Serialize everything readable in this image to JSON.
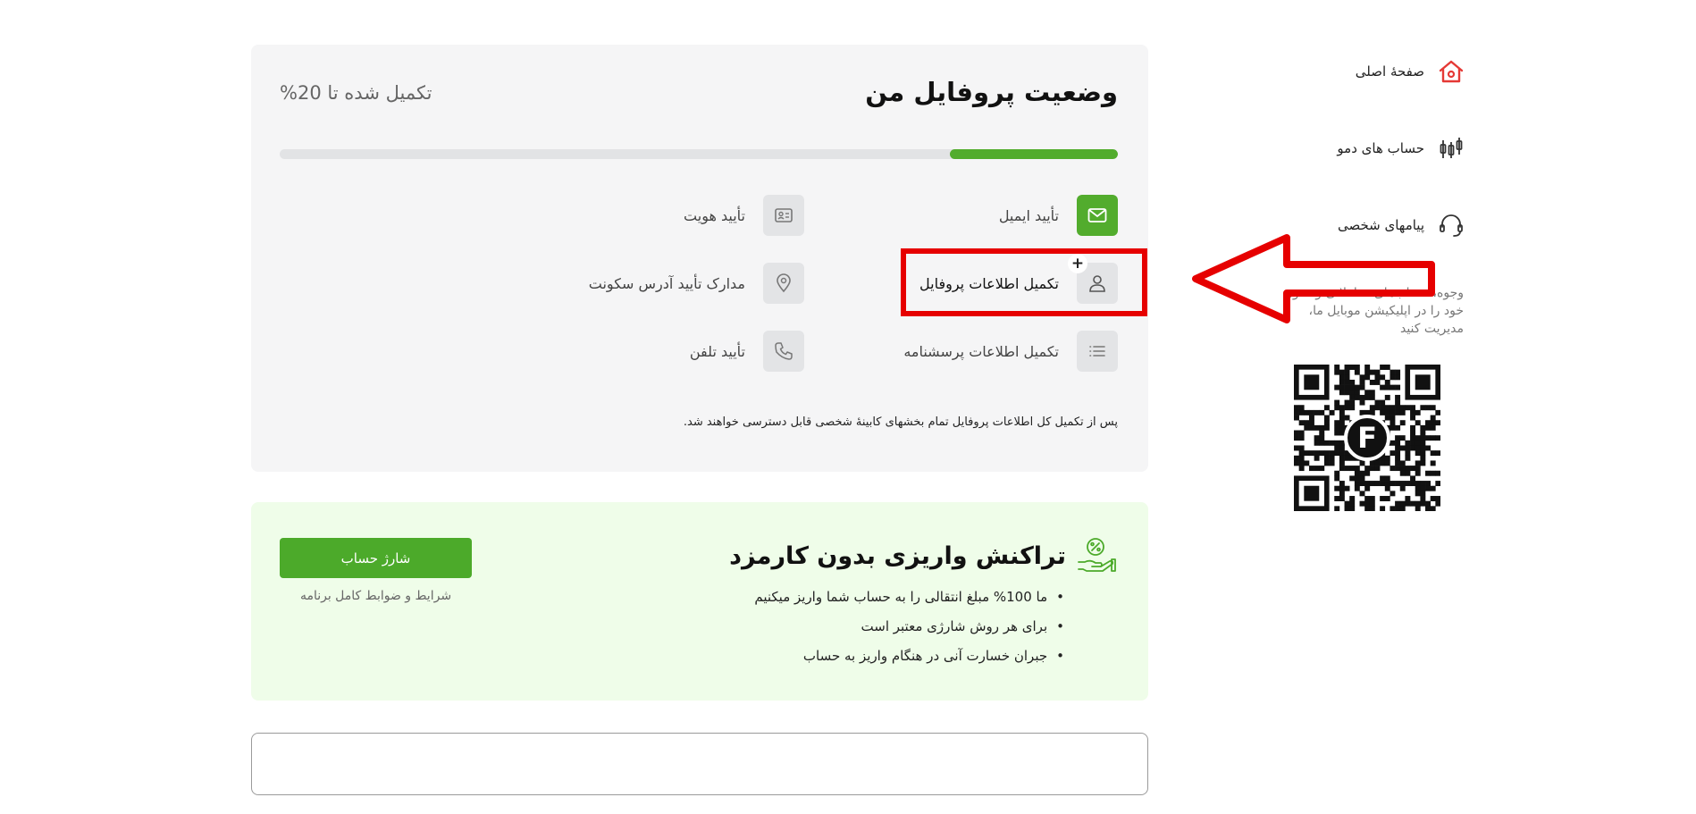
{
  "sidebar": {
    "items": [
      {
        "label": "صفحهٔ اصلی",
        "icon": "home-icon"
      },
      {
        "label": "حساب های دمو",
        "icon": "candlestick-icon"
      },
      {
        "label": "پیامهای شخصی",
        "icon": "headset-icon"
      }
    ],
    "promo_text": "وجوه، حساب‌های معاملاتی و دموی خود را در اپلیکیشن موبایل ما، مدیریت کنید",
    "qr_center_letter": "F"
  },
  "profile": {
    "title": "وضعیت پروفایل من",
    "progress_text": "تکمیل شده تا 20%",
    "progress_fraction": 0.2,
    "steps": [
      {
        "label": "تأیید ایمیل",
        "icon": "envelope-icon",
        "status": "done"
      },
      {
        "label": "تأیید هویت",
        "icon": "id-card-icon",
        "status": "pending"
      },
      {
        "label": "تکمیل اطلاعات پروفایل",
        "icon": "user-icon",
        "status": "active",
        "badge": "+"
      },
      {
        "label": "مدارک تأیید آدرس سکونت",
        "icon": "location-pin-icon",
        "status": "pending"
      },
      {
        "label": "تکمیل اطلاعات پرسشنامه",
        "icon": "list-icon",
        "status": "pending"
      },
      {
        "label": "تأیید تلفن",
        "icon": "phone-icon",
        "status": "pending"
      }
    ],
    "note": "پس از تکمیل کل اطلاعات پروفایل تمام بخشهای کابینهٔ شخصی قابل دسترسی خواهند شد."
  },
  "promo": {
    "title": "تراکنش واریزی بدون کارمزد",
    "icon": "hand-percent-icon",
    "bullets": [
      "ما 100% مبلغ انتقالی را به حساب شما واریز میکنیم",
      "برای هر روش شارژی معتبر است",
      "جبران خسارت آنی در هنگام واریز به حساب"
    ],
    "button_label": "شارژ حساب",
    "terms_label": "شرایط و ضوابط کامل برنامه"
  },
  "colors": {
    "accent_green": "#52ac2d",
    "card_gray": "#f5f5f6",
    "promo_green_bg": "#effde9",
    "annotation_red": "#e60000",
    "home_icon_red": "#e53935"
  }
}
